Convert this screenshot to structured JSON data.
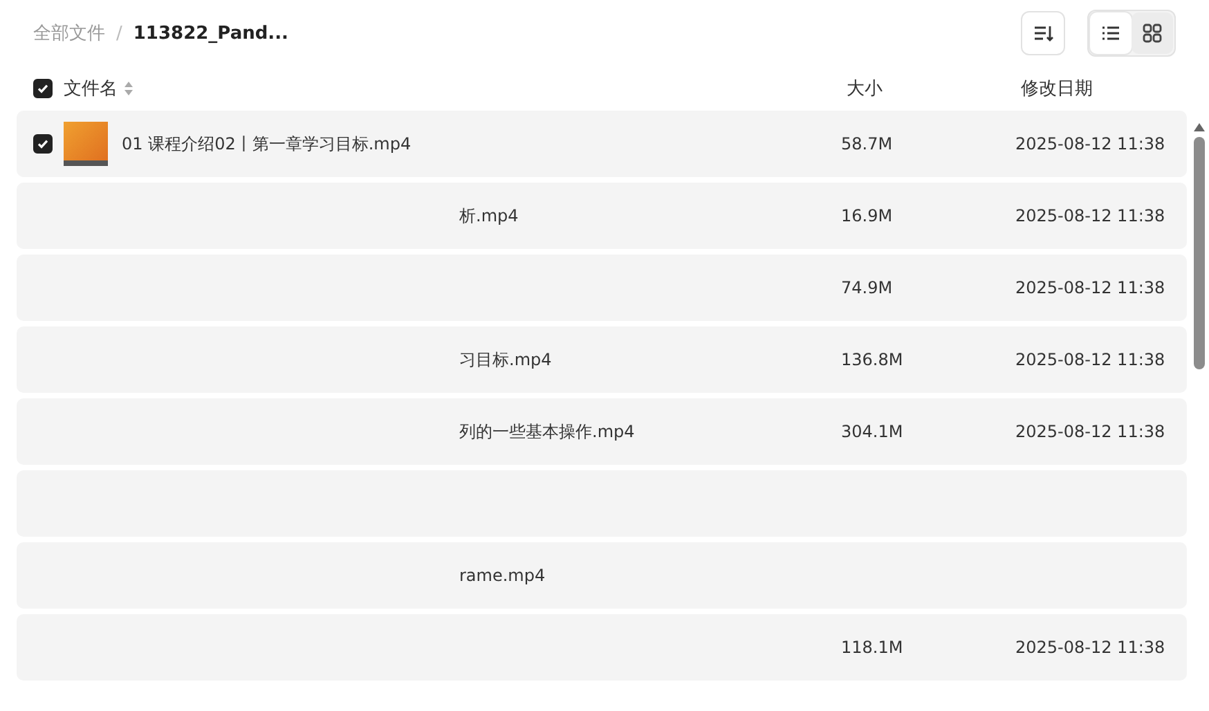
{
  "breadcrumb_separator": "/",
  "breadcrumb": [
    {
      "label": "全部文件",
      "current": false
    },
    {
      "label": "113822_Pand...",
      "current": true
    }
  ],
  "toolbar": {
    "view_modes": [
      {
        "kind": "list",
        "selected": true
      },
      {
        "kind": "grid",
        "selected": false
      }
    ]
  },
  "table": {
    "select_all_checked": true,
    "columns": [
      {
        "label": "文件名",
        "sortable": true
      },
      {
        "label": "大小"
      },
      {
        "label": "修改日期"
      }
    ],
    "rows": [
      {
        "name": "01 课程介绍02丨第一章学习目标.mp4",
        "size": "58.7M",
        "date": "2025-08-12 11:38",
        "checked": true,
        "thumbnail": true
      },
      {
        "name": "析.mp4",
        "size": "16.9M",
        "date": "2025-08-12 11:38"
      },
      {
        "size": "74.9M",
        "date": "2025-08-12 11:38"
      },
      {
        "name": "习目标.mp4",
        "size": "136.8M",
        "date": "2025-08-12 11:38"
      },
      {
        "name": "列的一些基本操作.mp4",
        "size": "304.1M",
        "date": "2025-08-12 11:38"
      },
      {},
      {
        "name": "rame.mp4"
      },
      {
        "size": "118.1M",
        "date": "2025-08-12 11:38"
      }
    ]
  }
}
